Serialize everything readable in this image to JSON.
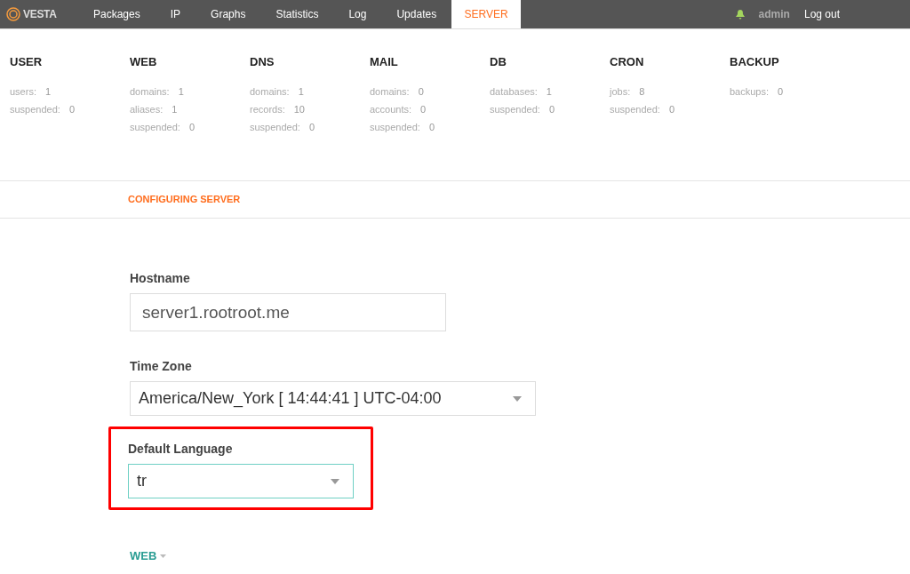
{
  "logo": {
    "text": "VESTA"
  },
  "nav": [
    {
      "label": "Packages",
      "selected": false
    },
    {
      "label": "IP",
      "selected": false
    },
    {
      "label": "Graphs",
      "selected": false
    },
    {
      "label": "Statistics",
      "selected": false
    },
    {
      "label": "Log",
      "selected": false
    },
    {
      "label": "Updates",
      "selected": false
    },
    {
      "label": "SERVER",
      "selected": true
    }
  ],
  "user": {
    "name": "admin",
    "logout": "Log out"
  },
  "stats": [
    {
      "title": "USER",
      "rows": [
        {
          "label": "users:",
          "value": "1"
        },
        {
          "label": "suspended:",
          "value": "0"
        }
      ]
    },
    {
      "title": "WEB",
      "rows": [
        {
          "label": "domains:",
          "value": "1"
        },
        {
          "label": "aliases:",
          "value": "1"
        },
        {
          "label": "suspended:",
          "value": "0"
        }
      ]
    },
    {
      "title": "DNS",
      "rows": [
        {
          "label": "domains:",
          "value": "1"
        },
        {
          "label": "records:",
          "value": "10"
        },
        {
          "label": "suspended:",
          "value": "0"
        }
      ]
    },
    {
      "title": "MAIL",
      "rows": [
        {
          "label": "domains:",
          "value": "0"
        },
        {
          "label": "accounts:",
          "value": "0"
        },
        {
          "label": "suspended:",
          "value": "0"
        }
      ]
    },
    {
      "title": "DB",
      "rows": [
        {
          "label": "databases:",
          "value": "1"
        },
        {
          "label": "suspended:",
          "value": "0"
        }
      ]
    },
    {
      "title": "CRON",
      "rows": [
        {
          "label": "jobs:",
          "value": "8"
        },
        {
          "label": "suspended:",
          "value": "0"
        }
      ]
    },
    {
      "title": "BACKUP",
      "rows": [
        {
          "label": "backups:",
          "value": "0"
        }
      ]
    }
  ],
  "section_title": "CONFIGURING SERVER",
  "fields": [
    {
      "kind": "input",
      "label": "Hostname",
      "value": "server1.rootroot.me",
      "focused": false,
      "highlighted": false
    },
    {
      "kind": "select",
      "label": "Time Zone",
      "value": "America/New_York [ 14:44:41 ] UTC-04:00",
      "focused": false,
      "highlighted": false
    },
    {
      "kind": "select",
      "label": "Default Language",
      "value": "tr",
      "focused": true,
      "highlighted": true
    }
  ],
  "web_section": {
    "label": "WEB",
    "expanded": false
  }
}
